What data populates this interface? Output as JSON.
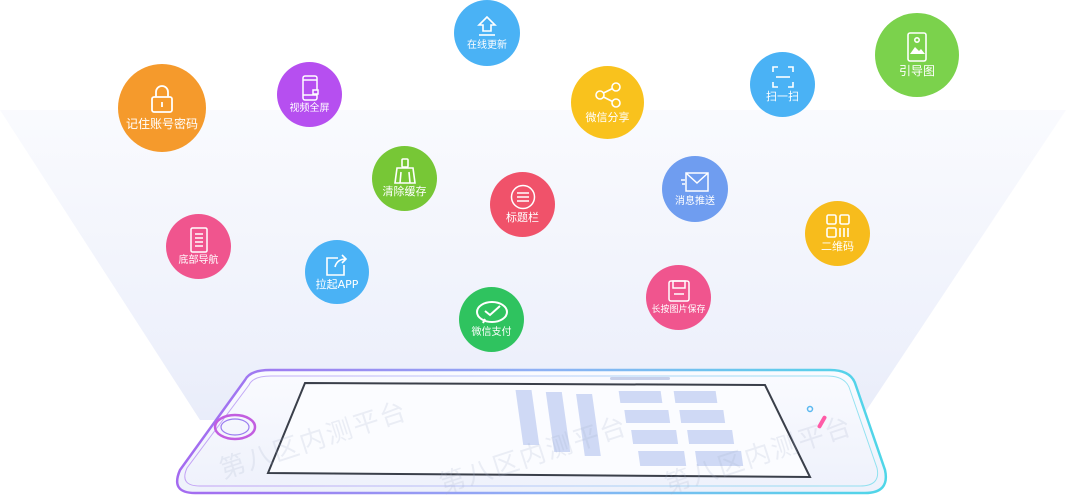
{
  "features": {
    "remember_password": {
      "label": "记住账号密码",
      "icon": "lock-icon",
      "color": "#f59a2c"
    },
    "video_fullscreen": {
      "label": "视频全屏",
      "icon": "phone-screen-icon",
      "color": "#b64ff0"
    },
    "online_update": {
      "label": "在线更新",
      "icon": "upload-arrow-icon",
      "color": "#4ab2f5"
    },
    "wechat_share": {
      "label": "微信分享",
      "icon": "share-icon",
      "color": "#f9c21d"
    },
    "scan": {
      "label": "扫一扫",
      "icon": "scan-icon",
      "color": "#4ab2f5"
    },
    "guide_page": {
      "label": "引导图",
      "icon": "guide-image-icon",
      "color": "#7bd24c"
    },
    "clear_cache": {
      "label": "清除缓存",
      "icon": "broom-icon",
      "color": "#77c736"
    },
    "title_bar": {
      "label": "标题栏",
      "icon": "list-icon",
      "color": "#f0526a"
    },
    "push_message": {
      "label": "消息推送",
      "icon": "envelope-icon",
      "color": "#6f9df0"
    },
    "qr_code": {
      "label": "二维码",
      "icon": "qrcode-icon",
      "color": "#f7bc1c"
    },
    "bottom_nav": {
      "label": "底部导航",
      "icon": "nav-doc-icon",
      "color": "#f0558e"
    },
    "open_app": {
      "label": "拉起APP",
      "icon": "external-link-icon",
      "color": "#4ab2f5"
    },
    "wechat_pay": {
      "label": "微信支付",
      "icon": "wechat-pay-icon",
      "color": "#2fc35f"
    },
    "save_image": {
      "label": "长按图片保存",
      "icon": "save-icon",
      "color": "#f0558e"
    }
  },
  "watermark": "第八区内测平台"
}
